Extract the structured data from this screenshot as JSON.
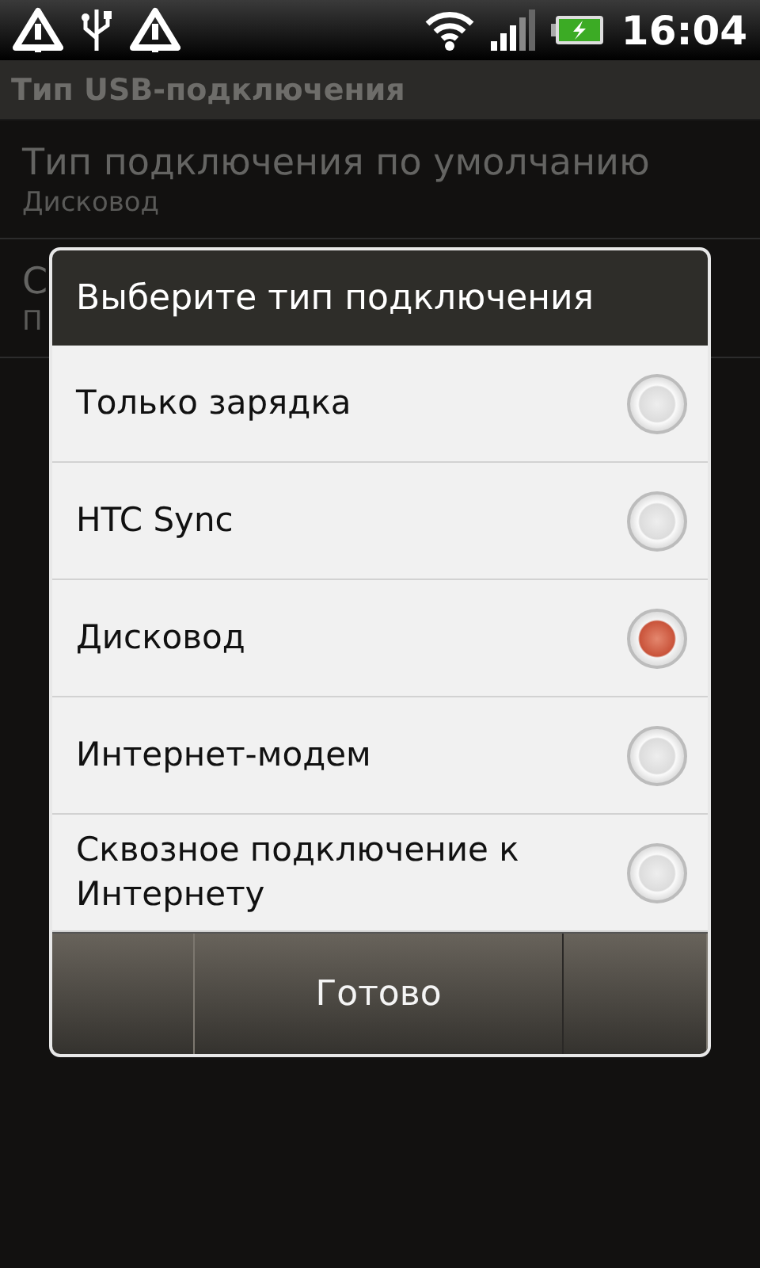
{
  "status_bar": {
    "time": "16:04"
  },
  "title_bar": {
    "title": "Тип USB-подключения"
  },
  "settings": [
    {
      "title": "Тип подключения по умолчанию",
      "subtitle": "Дисковод"
    },
    {
      "title": "С",
      "subtitle": "П"
    }
  ],
  "dialog": {
    "title": "Выберите тип подключения",
    "options": [
      {
        "label": "Только зарядка",
        "selected": false
      },
      {
        "label": "HTC Sync",
        "selected": false
      },
      {
        "label": "Дисковод",
        "selected": true
      },
      {
        "label": "Интернет-модем",
        "selected": false
      },
      {
        "label": "Сквозное подключение к Интернету",
        "selected": false
      }
    ],
    "button": "Готово"
  }
}
